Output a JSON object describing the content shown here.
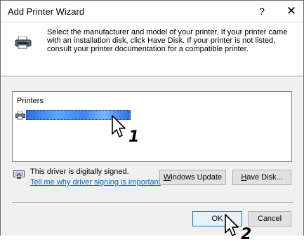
{
  "window": {
    "title": "Add Printer Wizard",
    "help_glyph": "?",
    "close_glyph": "✕"
  },
  "header": {
    "icon": "printer-icon",
    "instructions": "Select the manufacturer and model of your printer. If your printer came with an installation disk, click Have Disk. If your printer is not listed, consult your printer documentation for a compatible printer."
  },
  "printers_list": {
    "header": "Printers",
    "selected_item_label": "",
    "selected_item_icon": "printer-small-icon"
  },
  "annotations": {
    "step1": "1",
    "step2": "2"
  },
  "signature": {
    "icon": "signed-driver-icon",
    "text": "This driver is digitally signed.",
    "link": "Tell me why driver signing is important"
  },
  "buttons": {
    "windows_update": "Windows Update",
    "have_disk_prefix": "",
    "have_disk_access": "H",
    "have_disk_rest": "ave Disk...",
    "windows_update_access": "W",
    "windows_update_rest": "indows Update",
    "ok": "OK",
    "cancel": "Cancel"
  },
  "colors": {
    "selection": "#3b85f0",
    "link": "#0066cc",
    "focus_border": "#0078d7"
  }
}
